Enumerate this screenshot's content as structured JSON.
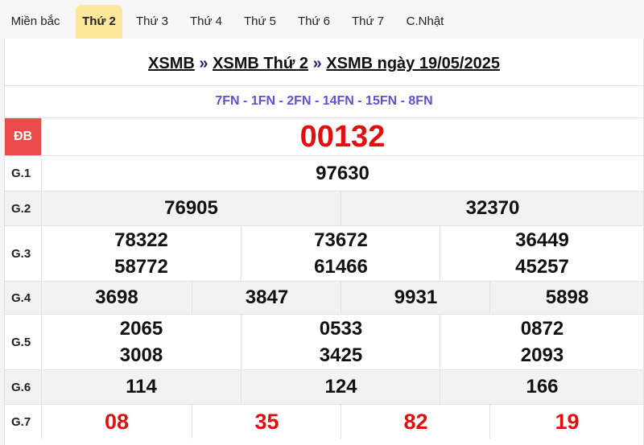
{
  "tabs": [
    {
      "label": "Miền bắc",
      "active": false
    },
    {
      "label": "Thứ 2",
      "active": true
    },
    {
      "label": "Thứ 3",
      "active": false
    },
    {
      "label": "Thứ 4",
      "active": false
    },
    {
      "label": "Thứ 5",
      "active": false
    },
    {
      "label": "Thứ 6",
      "active": false
    },
    {
      "label": "Thứ 7",
      "active": false
    },
    {
      "label": "C.Nhật",
      "active": false
    }
  ],
  "breadcrumb": {
    "part1": "XSMB",
    "sep": "»",
    "part2": "XSMB Thứ 2",
    "part3": "XSMB ngày 19/05/2025"
  },
  "codes": "7FN - 1FN - 2FN - 14FN - 15FN - 8FN",
  "prizes": {
    "db": {
      "label": "ĐB",
      "values": [
        "00132"
      ]
    },
    "g1": {
      "label": "G.1",
      "values": [
        "97630"
      ]
    },
    "g2": {
      "label": "G.2",
      "values": [
        "76905",
        "32370"
      ]
    },
    "g3": {
      "label": "G.3",
      "values": [
        "78322",
        "73672",
        "36449",
        "58772",
        "61466",
        "45257"
      ]
    },
    "g4": {
      "label": "G.4",
      "values": [
        "3698",
        "3847",
        "9931",
        "5898"
      ]
    },
    "g5": {
      "label": "G.5",
      "values": [
        "2065",
        "0533",
        "0872",
        "3008",
        "3425",
        "2093"
      ]
    },
    "g6": {
      "label": "G.6",
      "values": [
        "114",
        "124",
        "166"
      ]
    },
    "g7": {
      "label": "G.7",
      "values": [
        "08",
        "35",
        "82",
        "19"
      ]
    }
  },
  "colors": {
    "accent_tab": "#fde79a",
    "db_label": "#e94b4b",
    "red_number": "#e01010",
    "codes": "#5b52d6"
  }
}
